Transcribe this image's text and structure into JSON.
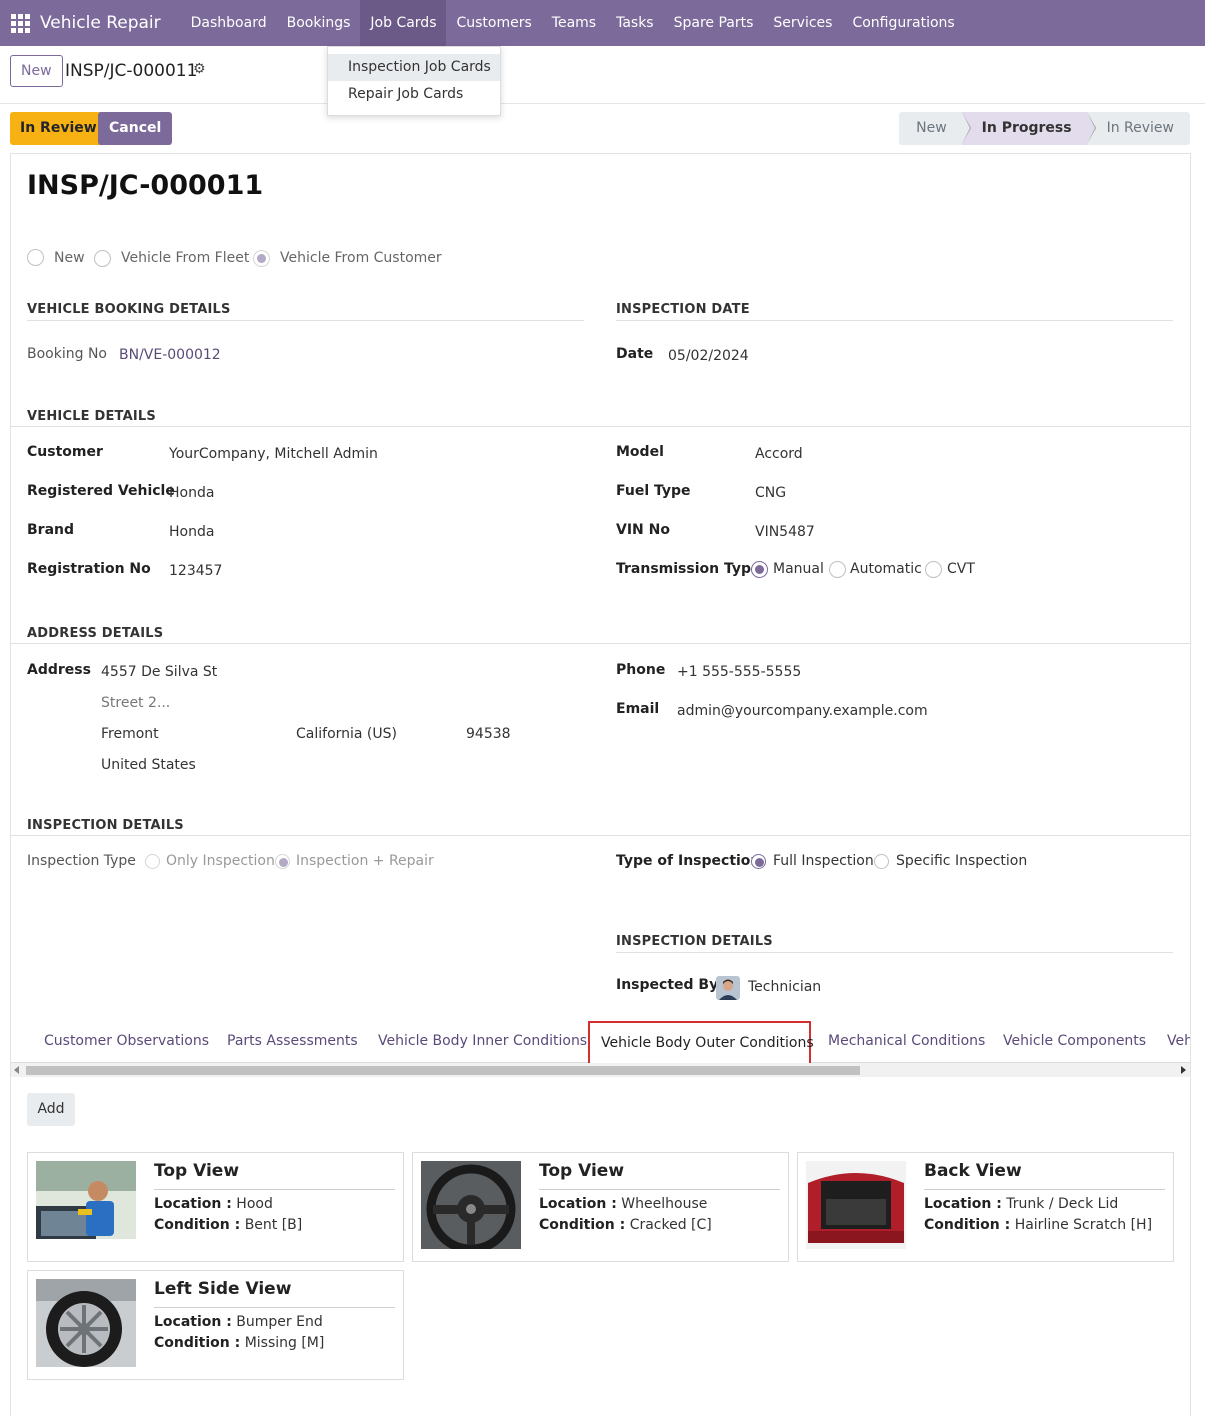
{
  "app": {
    "name": "Vehicle Repair"
  },
  "menu": [
    {
      "label": "Dashboard"
    },
    {
      "label": "Bookings"
    },
    {
      "label": "Job Cards"
    },
    {
      "label": "Customers"
    },
    {
      "label": "Teams"
    },
    {
      "label": "Tasks"
    },
    {
      "label": "Spare Parts"
    },
    {
      "label": "Services"
    },
    {
      "label": "Configurations"
    }
  ],
  "dropdown": {
    "items": [
      "Inspection Job Cards",
      "Repair Job Cards"
    ]
  },
  "control": {
    "new_label": "New",
    "breadcrumb": "INSP/JC-000011"
  },
  "actions": {
    "review": "In Review",
    "cancel": "Cancel"
  },
  "stages": [
    "New",
    "In Progress",
    "In Review"
  ],
  "record": {
    "title": "INSP/JC-000011",
    "source_options": [
      "New",
      "Vehicle From Fleet",
      "Vehicle From Customer"
    ],
    "booking": {
      "section": "VEHICLE BOOKING DETAILS",
      "label": "Booking No",
      "value": "BN/VE-000012"
    },
    "inspection_date": {
      "section": "INSPECTION DATE",
      "label": "Date",
      "value": "05/02/2024"
    },
    "vehicle": {
      "section": "VEHICLE DETAILS",
      "left": [
        {
          "label": "Customer",
          "value": "YourCompany, Mitchell Admin"
        },
        {
          "label": "Registered Vehicle",
          "value": "Honda"
        },
        {
          "label": "Brand",
          "value": "Honda"
        },
        {
          "label": "Registration No",
          "value": "123457"
        }
      ],
      "right": [
        {
          "label": "Model",
          "value": "Accord"
        },
        {
          "label": "Fuel Type",
          "value": "CNG"
        },
        {
          "label": "VIN No",
          "value": "VIN5487"
        }
      ],
      "transmission": {
        "label": "Transmission Type",
        "options": [
          "Manual",
          "Automatic",
          "CVT"
        ]
      }
    },
    "address": {
      "section": "ADDRESS DETAILS",
      "label": "Address",
      "street": "4557 De Silva St",
      "street2_placeholder": "Street 2...",
      "city": "Fremont",
      "state": "California (US)",
      "zip": "94538",
      "country": "United States",
      "phone_label": "Phone",
      "phone": "+1 555-555-5555",
      "email_label": "Email",
      "email": "admin@yourcompany.example.com"
    },
    "inspection": {
      "section": "INSPECTION DETAILS",
      "type_label": "Inspection Type",
      "type_options": [
        "Only Inspection",
        "Inspection + Repair"
      ],
      "kind_label": "Type of Inspection",
      "kind_options": [
        "Full Inspection",
        "Specific Inspection"
      ],
      "section2": "INSPECTION DETAILS",
      "by_label": "Inspected By",
      "by_value": "Technician"
    }
  },
  "tabs": [
    "Customer Observations",
    "Parts Assessments",
    "Vehicle Body Inner Conditions",
    "Vehicle Body Outer Conditions",
    "Mechanical Conditions",
    "Vehicle Components",
    "Veh"
  ],
  "add_label": "Add",
  "cards": [
    {
      "title": "Top View",
      "location": "Hood",
      "condition": "Bent [B]"
    },
    {
      "title": "Top View",
      "location": "Wheelhouse",
      "condition": "Cracked [C]"
    },
    {
      "title": "Back View",
      "location": "Trunk / Deck Lid",
      "condition": "Hairline Scratch [H]"
    },
    {
      "title": "Left Side View",
      "location": "Bumper End",
      "condition": "Missing [M]"
    }
  ],
  "card_labels": {
    "location": "Location :",
    "condition": "Condition :"
  },
  "colors": {
    "primary": "#7c6a9a",
    "warning": "#f7b112",
    "highlight": "#d32f2f"
  }
}
